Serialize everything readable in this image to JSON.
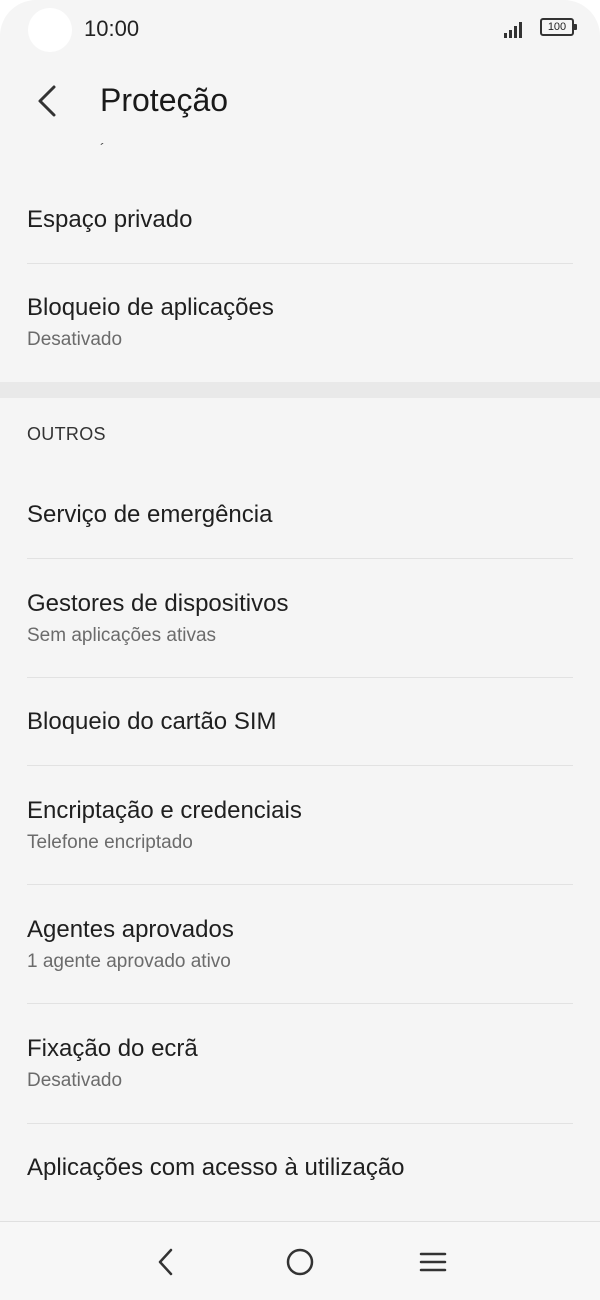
{
  "status_bar": {
    "time": "10:00",
    "battery": "100",
    "signal_icon": "signal-icon"
  },
  "header": {
    "title": "Proteção",
    "back_icon": "back-arrow-icon",
    "scroll_accent": "´"
  },
  "items_top": [
    {
      "title": "Espaço privado",
      "subtitle": ""
    },
    {
      "title": "Bloqueio de aplicações",
      "subtitle": "Desativado"
    }
  ],
  "section": {
    "label": "OUTROS"
  },
  "items_other": [
    {
      "title": "Serviço de emergência",
      "subtitle": ""
    },
    {
      "title": "Gestores de dispositivos",
      "subtitle": "Sem aplicações ativas"
    },
    {
      "title": "Bloqueio do cartão SIM",
      "subtitle": ""
    },
    {
      "title": "Encriptação e credenciais",
      "subtitle": "Telefone encriptado"
    },
    {
      "title": "Agentes aprovados",
      "subtitle": "1 agente aprovado ativo"
    },
    {
      "title": "Fixação do ecrã",
      "subtitle": "Desativado"
    },
    {
      "title": "Aplicações com acesso à utilização",
      "subtitle": ""
    }
  ],
  "navbar": {
    "back_icon": "nav-back-icon",
    "home_icon": "nav-home-icon",
    "menu_icon": "nav-menu-icon"
  }
}
